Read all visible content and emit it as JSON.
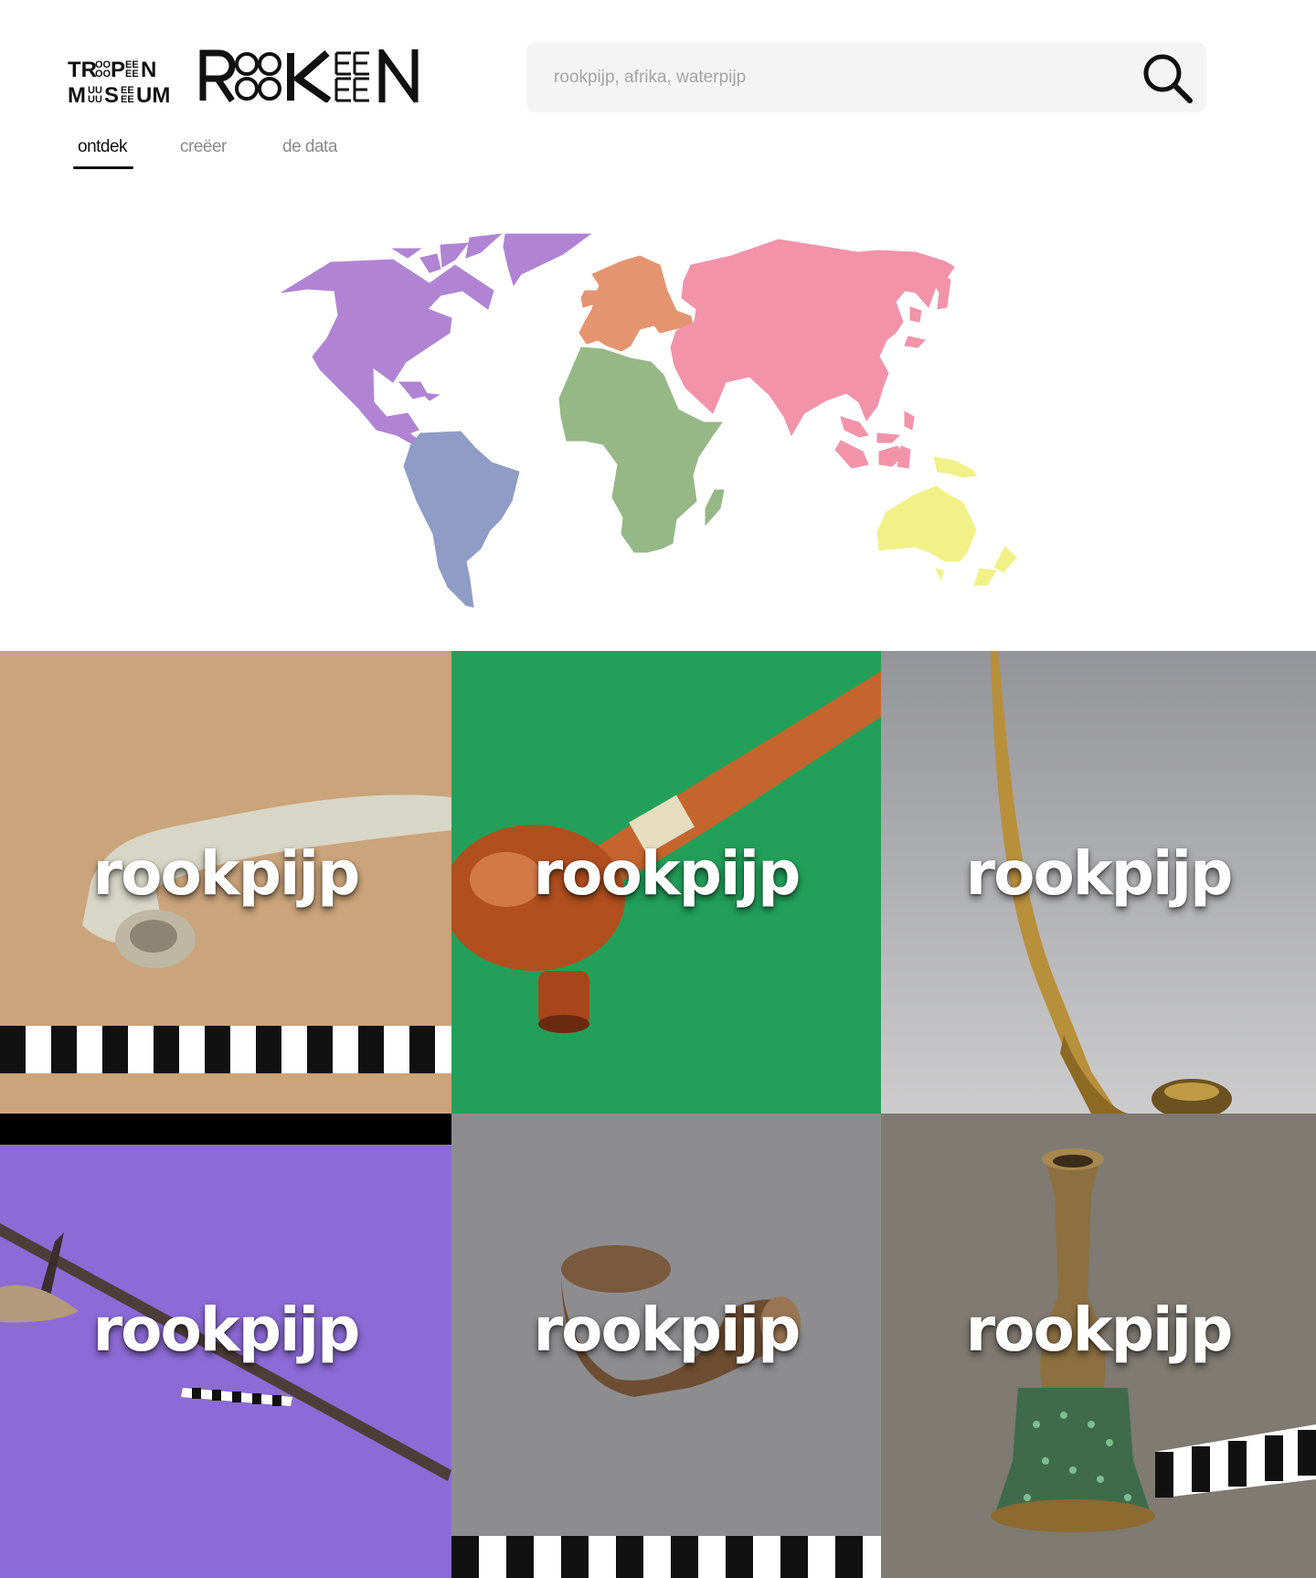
{
  "brand": {
    "museum_logo": "TROPEN MUSEUM",
    "project_logo": "ROOKEN"
  },
  "search": {
    "placeholder": "rookpijp, afrika, waterpijp",
    "icon": "search-icon"
  },
  "tabs": [
    {
      "label": "ontdek",
      "active": true
    },
    {
      "label": "creëer",
      "active": false
    },
    {
      "label": "de data",
      "active": false
    }
  ],
  "map": {
    "regions": [
      {
        "name": "north-america",
        "color": "#b084d3"
      },
      {
        "name": "south-america",
        "color": "#8e9cc6"
      },
      {
        "name": "europe",
        "color": "#e59470"
      },
      {
        "name": "africa",
        "color": "#96b886"
      },
      {
        "name": "asia",
        "color": "#f293aa"
      },
      {
        "name": "oceania",
        "color": "#f1f187"
      }
    ]
  },
  "results": [
    {
      "label": "rookpijp",
      "background": "#caa47a"
    },
    {
      "label": "rookpijp",
      "background": "#22a05a"
    },
    {
      "label": "rookpijp",
      "background": "#a3a3a6"
    },
    {
      "label": "rookpijp",
      "background": "#8c6bd6"
    },
    {
      "label": "rookpijp",
      "background": "#8d8d90"
    },
    {
      "label": "rookpijp",
      "background": "#7f7a72"
    }
  ]
}
